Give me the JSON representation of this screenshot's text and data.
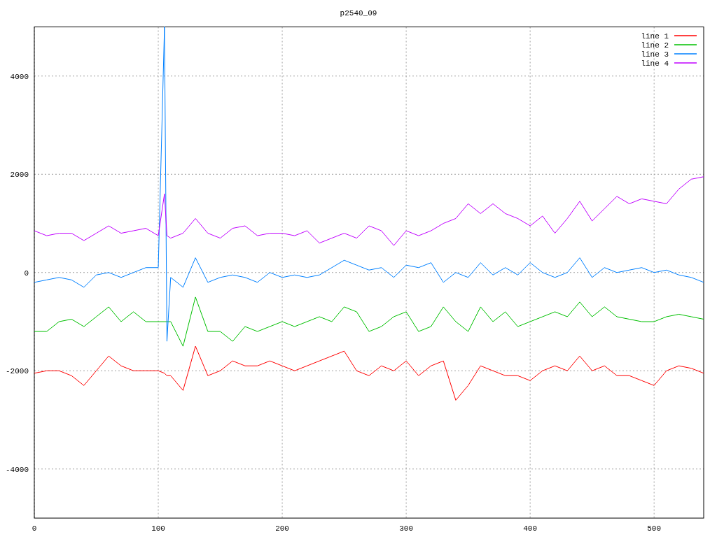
{
  "plot": {
    "chart_data": {
      "type": "line",
      "title": "p2540_09",
      "x": [
        0,
        10,
        20,
        30,
        40,
        50,
        60,
        70,
        80,
        90,
        100,
        105,
        107,
        110,
        120,
        130,
        140,
        150,
        160,
        170,
        180,
        190,
        200,
        210,
        220,
        230,
        240,
        250,
        260,
        270,
        280,
        290,
        300,
        310,
        320,
        330,
        340,
        350,
        360,
        370,
        380,
        390,
        400,
        410,
        420,
        430,
        440,
        450,
        460,
        470,
        480,
        490,
        500,
        510,
        520,
        530,
        540
      ],
      "series": [
        {
          "name": "line 1",
          "color": "#ff0000",
          "values": [
            -2050,
            -2000,
            -2000,
            -2100,
            -2300,
            -2000,
            -1700,
            -1900,
            -2000,
            -2000,
            -2000,
            -2050,
            -2100,
            -2100,
            -2400,
            -1500,
            -2100,
            -2000,
            -1800,
            -1900,
            -1900,
            -1800,
            -1900,
            -2000,
            -1900,
            -1800,
            -1700,
            -1600,
            -2000,
            -2100,
            -1900,
            -2000,
            -1800,
            -2100,
            -1900,
            -1800,
            -2600,
            -2300,
            -1900,
            -2000,
            -2100,
            -2100,
            -2200,
            -2000,
            -1900,
            -2000,
            -1700,
            -2000,
            -1900,
            -2100,
            -2100,
            -2200,
            -2300,
            -2000,
            -1900,
            -1950,
            -2050
          ]
        },
        {
          "name": "line 2",
          "color": "#00c000",
          "values": [
            -1200,
            -1200,
            -1000,
            -950,
            -1100,
            -900,
            -700,
            -1000,
            -800,
            -1000,
            -1000,
            -1000,
            -1000,
            -1000,
            -1500,
            -500,
            -1200,
            -1200,
            -1400,
            -1100,
            -1200,
            -1100,
            -1000,
            -1100,
            -1000,
            -900,
            -1000,
            -700,
            -800,
            -1200,
            -1100,
            -900,
            -800,
            -1200,
            -1100,
            -700,
            -1000,
            -1200,
            -700,
            -1000,
            -800,
            -1100,
            -1000,
            -900,
            -800,
            -900,
            -600,
            -900,
            -700,
            -900,
            -950,
            -1000,
            -1000,
            -900,
            -850,
            -900,
            -950
          ]
        },
        {
          "name": "line 3",
          "color": "#0080ff",
          "values": [
            -200,
            -150,
            -100,
            -150,
            -300,
            -50,
            0,
            -100,
            0,
            100,
            100,
            5000,
            -1400,
            -100,
            -300,
            300,
            -200,
            -100,
            -50,
            -100,
            -200,
            0,
            -100,
            -50,
            -100,
            -50,
            100,
            250,
            150,
            50,
            100,
            -100,
            150,
            100,
            200,
            -200,
            0,
            -100,
            200,
            -50,
            100,
            -50,
            200,
            0,
            -100,
            0,
            300,
            -100,
            100,
            0,
            50,
            100,
            0,
            50,
            -50,
            -100,
            -200
          ]
        },
        {
          "name": "line 4",
          "color": "#c000ff",
          "values": [
            850,
            750,
            800,
            800,
            650,
            800,
            950,
            800,
            850,
            900,
            750,
            1600,
            750,
            700,
            800,
            1100,
            800,
            700,
            900,
            950,
            750,
            800,
            800,
            750,
            850,
            600,
            700,
            800,
            700,
            950,
            850,
            550,
            850,
            750,
            850,
            1000,
            1100,
            1400,
            1200,
            1400,
            1200,
            1100,
            950,
            1150,
            800,
            1100,
            1450,
            1050,
            1300,
            1550,
            1400,
            1500,
            1450,
            1400,
            1700,
            1900,
            1950
          ]
        }
      ],
      "grid": true,
      "legend": true,
      "xlim": [
        0,
        540
      ],
      "ylim": [
        -5000,
        5000
      ],
      "xticks": [
        0,
        100,
        200,
        300,
        400,
        500
      ],
      "yticks": [
        -4000,
        -2000,
        0,
        2000,
        4000
      ]
    }
  }
}
